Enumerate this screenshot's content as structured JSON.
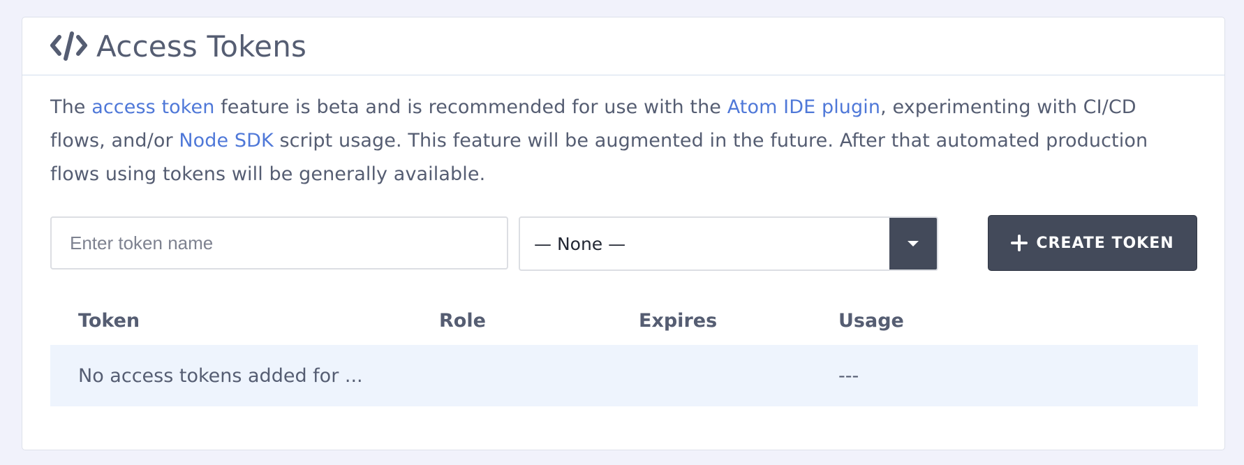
{
  "header": {
    "title": "Access Tokens",
    "icon": "code-icon"
  },
  "description": {
    "part1": "The ",
    "link1": "access token",
    "part2": " feature is beta and is recommended for use with the ",
    "link2": "Atom IDE plugin",
    "part3": ", experimenting with CI/CD flows, and/or ",
    "link3": "Node SDK",
    "part4": " script usage. This feature will be augmented in the future. After that automated production flows using tokens will be generally available."
  },
  "form": {
    "token_name_placeholder": "Enter token name",
    "token_name_value": "",
    "role_selected": "— None —",
    "create_button_label": "CREATE TOKEN"
  },
  "table": {
    "columns": [
      "Token",
      "Role",
      "Expires",
      "Usage"
    ],
    "rows": [
      {
        "token": "No access tokens added for ...",
        "role": "",
        "expires": "",
        "usage": "---"
      }
    ]
  },
  "colors": {
    "link": "#4f78d8",
    "button_dark": "#434a5a",
    "row_highlight": "#eef4fd",
    "page_background": "#f1f2fb"
  }
}
